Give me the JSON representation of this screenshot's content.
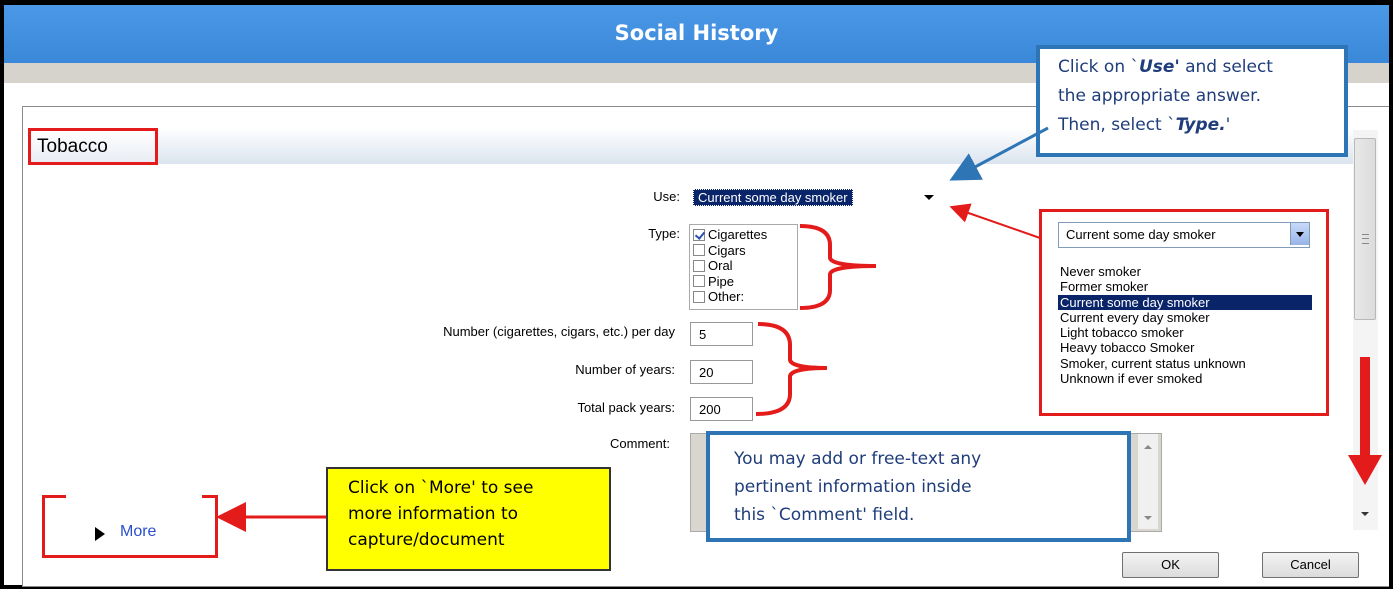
{
  "window": {
    "title": "Social History"
  },
  "section": {
    "title": "Tobacco"
  },
  "form": {
    "use_label": "Use:",
    "use_value": "Current some day smoker",
    "type_label": "Type:",
    "type_options": [
      {
        "label": "Cigarettes",
        "checked": true
      },
      {
        "label": "Cigars",
        "checked": false
      },
      {
        "label": "Oral",
        "checked": false
      },
      {
        "label": "Pipe",
        "checked": false
      },
      {
        "label": "Other:",
        "checked": false
      }
    ],
    "per_day_label": "Number (cigarettes, cigars, etc.) per day",
    "per_day_value": "5",
    "years_label": "Number of years:",
    "years_value": "20",
    "pack_years_label": "Total pack years:",
    "pack_years_value": "200",
    "comment_label": "Comment:"
  },
  "use_dropdown": {
    "selected": "Current some day smoker",
    "options": [
      "Never smoker",
      "Former smoker",
      "Current some day smoker",
      "Current every day smoker",
      "Light tobacco smoker",
      "Heavy tobacco Smoker",
      "Smoker, current status unknown",
      "Unknown if ever smoked"
    ],
    "highlighted_index": 2
  },
  "more": {
    "label": "More"
  },
  "buttons": {
    "ok": "OK",
    "cancel": "Cancel"
  },
  "callouts": {
    "use_type": {
      "line1_pre": "Click on `",
      "line1_em": "Use'",
      "line1_post": " and select",
      "line2": "the appropriate answer.",
      "line3_pre": "Then, select `",
      "line3_em": "Type.",
      "line3_post": "'"
    },
    "comment": [
      "You may add or free-text any",
      "pertinent information inside",
      "this `Comment' field."
    ],
    "more": [
      "Click on `More' to see",
      "more information to",
      "capture/document"
    ]
  },
  "colors": {
    "titlebar": "#3b88d9",
    "annotation_red": "#e31b1b",
    "callout_blue": "#2e75b6",
    "callout_yellow": "#ffff00",
    "selection": "#0a246a"
  }
}
